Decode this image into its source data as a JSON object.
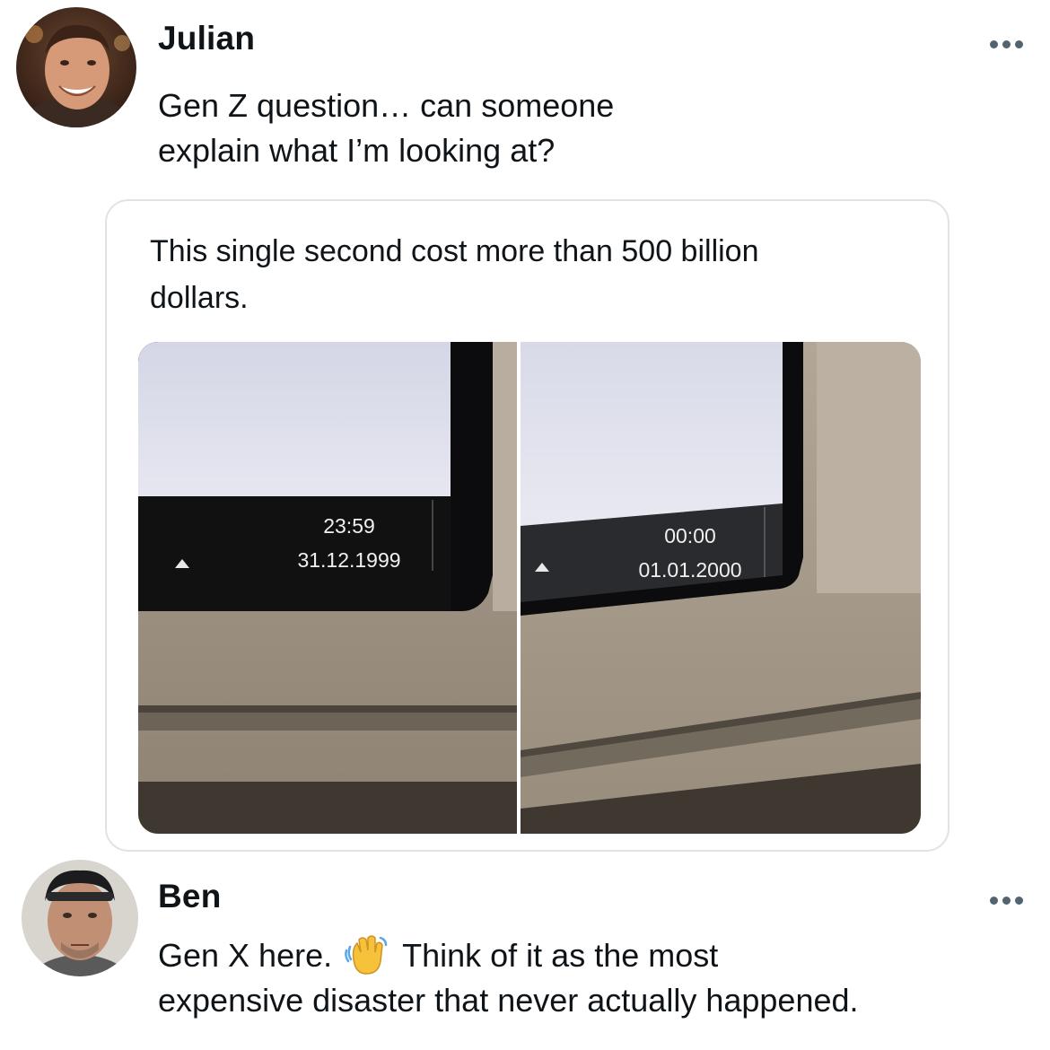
{
  "tweet": {
    "author": "Julian",
    "text_line1": "Gen Z question… can someone",
    "text_line2": "explain what I’m looking at?",
    "quote": {
      "text_line1": "This single second cost more than 500 billion",
      "text_line2": "dollars.",
      "photo_left": {
        "time": "23:59",
        "date": "31.12.1999"
      },
      "photo_right": {
        "time": "00:00",
        "date": "01.01.2000"
      }
    }
  },
  "reply": {
    "author": "Ben",
    "text_part1": "Gen X here.",
    "emoji_icon": "waving-hand-icon",
    "text_part2": "Think of it as the most",
    "text_line2": "expensive disaster that never actually happened."
  },
  "colors": {
    "text": "#0f1419",
    "secondary": "#536471",
    "border": "#dfe3e6"
  }
}
